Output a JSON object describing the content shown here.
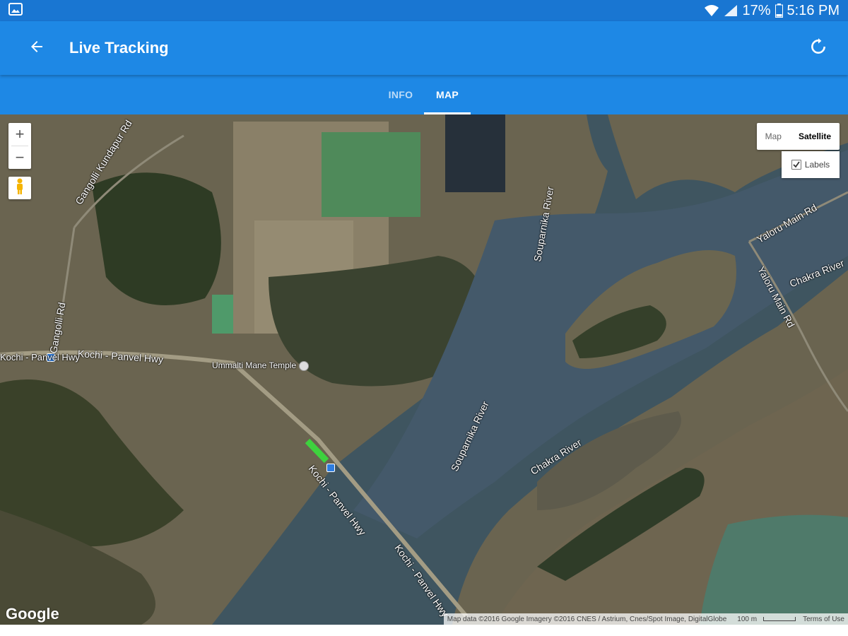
{
  "status_bar": {
    "battery_percent": "17%",
    "time": "5:16 PM"
  },
  "app_bar": {
    "title": "Live Tracking"
  },
  "tabs": [
    {
      "label": "INFO",
      "active": false
    },
    {
      "label": "MAP",
      "active": true
    }
  ],
  "map": {
    "zoom_in_label": "+",
    "zoom_out_label": "−",
    "map_type": {
      "map_label": "Map",
      "satellite_label": "Satellite",
      "selected": "Satellite",
      "labels_label": "Labels",
      "labels_checked": true
    },
    "labels": {
      "road_1": "Gangolli Kundapur Rd",
      "road_2": "Kochi - Panvel Hwy",
      "road_3": "Kochi - Panvel Hwy",
      "road_4": "Kochi - Panvel Hwy",
      "road_5": "Kochi - Panvel Hwy",
      "road_6": "Yaloru Main Rd",
      "road_7": "Yaloru Main Rd",
      "road_8": "Gangolli Rd",
      "river_1": "Souparnika River",
      "river_2": "Souparnika River",
      "river_3": "Chakra River",
      "river_4": "Chakra River",
      "poi_temple": "Ummalti Mane Temple"
    },
    "google_logo": "Google",
    "attribution": "Map data ©2016 Google Imagery ©2016 CNES / Astrium, Cnes/Spot Image, DigitalGlobe",
    "scale": "100 m",
    "terms": "Terms of Use"
  }
}
